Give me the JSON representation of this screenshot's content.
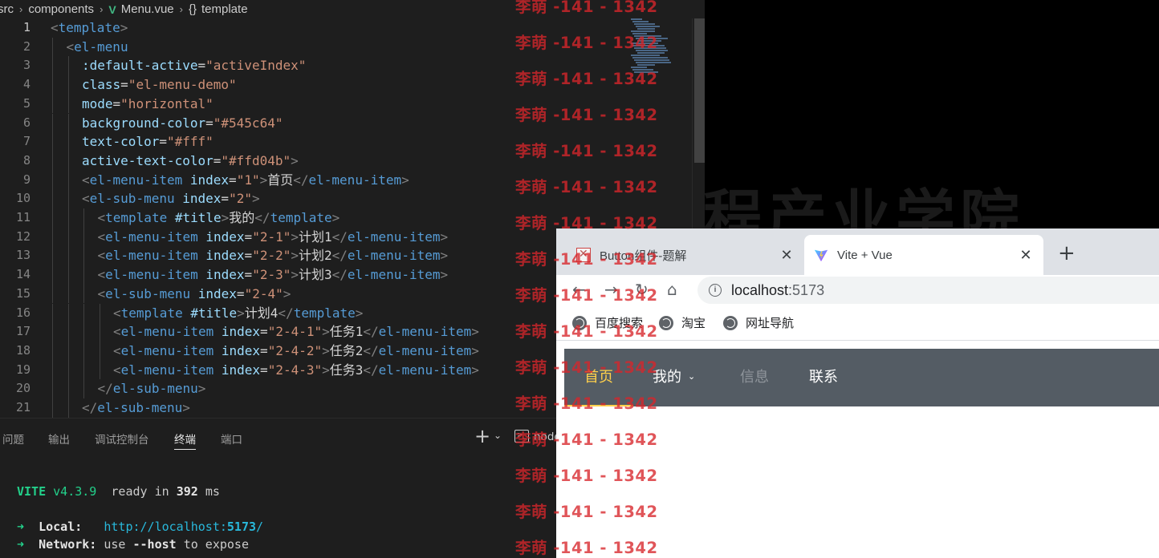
{
  "editor": {
    "breadcrumb": {
      "items": [
        "src",
        "components",
        "Menu.vue",
        "template"
      ],
      "vue_icon": "V",
      "template_icon": "{}",
      "separator": "›"
    },
    "lines": [
      {
        "n": "1",
        "indent": 0,
        "parts": [
          [
            "brk",
            "<"
          ],
          [
            "tag",
            "template"
          ],
          [
            "brk",
            ">"
          ]
        ]
      },
      {
        "n": "2",
        "indent": 1,
        "parts": [
          [
            "brk",
            "<"
          ],
          [
            "tag",
            "el-menu"
          ]
        ]
      },
      {
        "n": "3",
        "indent": 2,
        "parts": [
          [
            "attr",
            ":default-active"
          ],
          [
            "txt",
            "="
          ],
          [
            "str",
            "\"activeIndex\""
          ]
        ]
      },
      {
        "n": "4",
        "indent": 2,
        "parts": [
          [
            "attr",
            "class"
          ],
          [
            "txt",
            "="
          ],
          [
            "str",
            "\"el-menu-demo\""
          ]
        ]
      },
      {
        "n": "5",
        "indent": 2,
        "parts": [
          [
            "attr",
            "mode"
          ],
          [
            "txt",
            "="
          ],
          [
            "str",
            "\"horizontal\""
          ]
        ]
      },
      {
        "n": "6",
        "indent": 2,
        "parts": [
          [
            "attr",
            "background-color"
          ],
          [
            "txt",
            "="
          ],
          [
            "str",
            "\"#545c64\""
          ]
        ]
      },
      {
        "n": "7",
        "indent": 2,
        "parts": [
          [
            "attr",
            "text-color"
          ],
          [
            "txt",
            "="
          ],
          [
            "str",
            "\"#fff\""
          ]
        ]
      },
      {
        "n": "8",
        "indent": 2,
        "parts": [
          [
            "attr",
            "active-text-color"
          ],
          [
            "txt",
            "="
          ],
          [
            "str",
            "\"#ffd04b\""
          ],
          [
            "brk",
            ">"
          ]
        ]
      },
      {
        "n": "9",
        "indent": 2,
        "parts": [
          [
            "brk",
            "<"
          ],
          [
            "tag",
            "el-menu-item"
          ],
          [
            "txt",
            " "
          ],
          [
            "attr",
            "index"
          ],
          [
            "txt",
            "="
          ],
          [
            "str",
            "\"1\""
          ],
          [
            "brk",
            ">"
          ],
          [
            "txt",
            "首页"
          ],
          [
            "brk",
            "</"
          ],
          [
            "tag",
            "el-menu-item"
          ],
          [
            "brk",
            ">"
          ]
        ]
      },
      {
        "n": "10",
        "indent": 2,
        "parts": [
          [
            "brk",
            "<"
          ],
          [
            "tag",
            "el-sub-menu"
          ],
          [
            "txt",
            " "
          ],
          [
            "attr",
            "index"
          ],
          [
            "txt",
            "="
          ],
          [
            "str",
            "\"2\""
          ],
          [
            "brk",
            ">"
          ]
        ]
      },
      {
        "n": "11",
        "indent": 3,
        "parts": [
          [
            "brk",
            "<"
          ],
          [
            "tag",
            "template"
          ],
          [
            "txt",
            " "
          ],
          [
            "attr",
            "#title"
          ],
          [
            "brk",
            ">"
          ],
          [
            "txt",
            "我的"
          ],
          [
            "brk",
            "</"
          ],
          [
            "tag",
            "template"
          ],
          [
            "brk",
            ">"
          ]
        ]
      },
      {
        "n": "12",
        "indent": 3,
        "parts": [
          [
            "brk",
            "<"
          ],
          [
            "tag",
            "el-menu-item"
          ],
          [
            "txt",
            " "
          ],
          [
            "attr",
            "index"
          ],
          [
            "txt",
            "="
          ],
          [
            "str",
            "\"2-1\""
          ],
          [
            "brk",
            ">"
          ],
          [
            "txt",
            "计划1"
          ],
          [
            "brk",
            "</"
          ],
          [
            "tag",
            "el-menu-item"
          ],
          [
            "brk",
            ">"
          ]
        ]
      },
      {
        "n": "13",
        "indent": 3,
        "parts": [
          [
            "brk",
            "<"
          ],
          [
            "tag",
            "el-menu-item"
          ],
          [
            "txt",
            " "
          ],
          [
            "attr",
            "index"
          ],
          [
            "txt",
            "="
          ],
          [
            "str",
            "\"2-2\""
          ],
          [
            "brk",
            ">"
          ],
          [
            "txt",
            "计划2"
          ],
          [
            "brk",
            "</"
          ],
          [
            "tag",
            "el-menu-item"
          ],
          [
            "brk",
            ">"
          ]
        ]
      },
      {
        "n": "14",
        "indent": 3,
        "parts": [
          [
            "brk",
            "<"
          ],
          [
            "tag",
            "el-menu-item"
          ],
          [
            "txt",
            " "
          ],
          [
            "attr",
            "index"
          ],
          [
            "txt",
            "="
          ],
          [
            "str",
            "\"2-3\""
          ],
          [
            "brk",
            ">"
          ],
          [
            "txt",
            "计划3"
          ],
          [
            "brk",
            "</"
          ],
          [
            "tag",
            "el-menu-item"
          ],
          [
            "brk",
            ">"
          ]
        ]
      },
      {
        "n": "15",
        "indent": 3,
        "parts": [
          [
            "brk",
            "<"
          ],
          [
            "tag",
            "el-sub-menu"
          ],
          [
            "txt",
            " "
          ],
          [
            "attr",
            "index"
          ],
          [
            "txt",
            "="
          ],
          [
            "str",
            "\"2-4\""
          ],
          [
            "brk",
            ">"
          ]
        ]
      },
      {
        "n": "16",
        "indent": 4,
        "parts": [
          [
            "brk",
            "<"
          ],
          [
            "tag",
            "template"
          ],
          [
            "txt",
            " "
          ],
          [
            "attr",
            "#title"
          ],
          [
            "brk",
            ">"
          ],
          [
            "txt",
            "计划4"
          ],
          [
            "brk",
            "</"
          ],
          [
            "tag",
            "template"
          ],
          [
            "brk",
            ">"
          ]
        ]
      },
      {
        "n": "17",
        "indent": 4,
        "parts": [
          [
            "brk",
            "<"
          ],
          [
            "tag",
            "el-menu-item"
          ],
          [
            "txt",
            " "
          ],
          [
            "attr",
            "index"
          ],
          [
            "txt",
            "="
          ],
          [
            "str",
            "\"2-4-1\""
          ],
          [
            "brk",
            ">"
          ],
          [
            "txt",
            "任务1"
          ],
          [
            "brk",
            "</"
          ],
          [
            "tag",
            "el-menu-item"
          ],
          [
            "brk",
            ">"
          ]
        ]
      },
      {
        "n": "18",
        "indent": 4,
        "parts": [
          [
            "brk",
            "<"
          ],
          [
            "tag",
            "el-menu-item"
          ],
          [
            "txt",
            " "
          ],
          [
            "attr",
            "index"
          ],
          [
            "txt",
            "="
          ],
          [
            "str",
            "\"2-4-2\""
          ],
          [
            "brk",
            ">"
          ],
          [
            "txt",
            "任务2"
          ],
          [
            "brk",
            "</"
          ],
          [
            "tag",
            "el-menu-item"
          ],
          [
            "brk",
            ">"
          ]
        ]
      },
      {
        "n": "19",
        "indent": 4,
        "parts": [
          [
            "brk",
            "<"
          ],
          [
            "tag",
            "el-menu-item"
          ],
          [
            "txt",
            " "
          ],
          [
            "attr",
            "index"
          ],
          [
            "txt",
            "="
          ],
          [
            "str",
            "\"2-4-3\""
          ],
          [
            "brk",
            ">"
          ],
          [
            "txt",
            "任务3"
          ],
          [
            "brk",
            "</"
          ],
          [
            "tag",
            "el-menu-item"
          ],
          [
            "brk",
            ">"
          ]
        ]
      },
      {
        "n": "20",
        "indent": 3,
        "parts": [
          [
            "brk",
            "</"
          ],
          [
            "tag",
            "el-sub-menu"
          ],
          [
            "brk",
            ">"
          ]
        ]
      },
      {
        "n": "21",
        "indent": 2,
        "parts": [
          [
            "brk",
            "</"
          ],
          [
            "tag",
            "el-sub-menu"
          ],
          [
            "brk",
            ">"
          ]
        ]
      }
    ],
    "active_line": "1"
  },
  "panel": {
    "tabs": [
      "问题",
      "输出",
      "调试控制台",
      "终端",
      "端口"
    ],
    "active_tab": "终端",
    "add_icon": "+",
    "dropdown_icon": "⌄",
    "terminal_icon": ">_",
    "terminal_name": "node",
    "terminal": {
      "vite_name": "VITE",
      "vite_version": "v4.3.9",
      "ready_text": "ready in",
      "ready_ms": "392",
      "ms_unit": "ms",
      "arrow": "➜",
      "local_label": "Local:",
      "local_url_prefix": "http://localhost:",
      "local_port": "5173",
      "local_url_suffix": "/",
      "network_label": "Network:",
      "network_use": "use",
      "network_flag": "--host",
      "network_rest": "to expose"
    }
  },
  "browser": {
    "tabs": [
      {
        "title": "Button组件-题解",
        "favicon": "csdn-icon",
        "close": "✕"
      },
      {
        "title": "Vite + Vue",
        "favicon": "vite-icon",
        "close": "✕"
      }
    ],
    "new_tab": "+",
    "nav": {
      "back": "←",
      "forward": "→",
      "reload": "↻",
      "home": "⌂"
    },
    "url": {
      "host": "localhost",
      "port": ":5173"
    },
    "bookmarks": [
      "百度搜索",
      "淘宝",
      "网址导航"
    ],
    "menu": {
      "background": "#545c64",
      "text_color": "#ffffff",
      "active_text_color": "#ffd04b",
      "disabled_color": "#8f959b",
      "items": [
        {
          "label": "首页",
          "state": "active"
        },
        {
          "label": "我的",
          "state": "submenu"
        },
        {
          "label": "信息",
          "state": "disabled"
        },
        {
          "label": "联系",
          "state": "normal"
        }
      ],
      "submenu_chevron": "⌄"
    }
  },
  "background": {
    "ghost_text": "程产业学院"
  },
  "watermark": {
    "text": "李萌 -141 - 1342",
    "color": "#d8262b",
    "count": 16
  }
}
